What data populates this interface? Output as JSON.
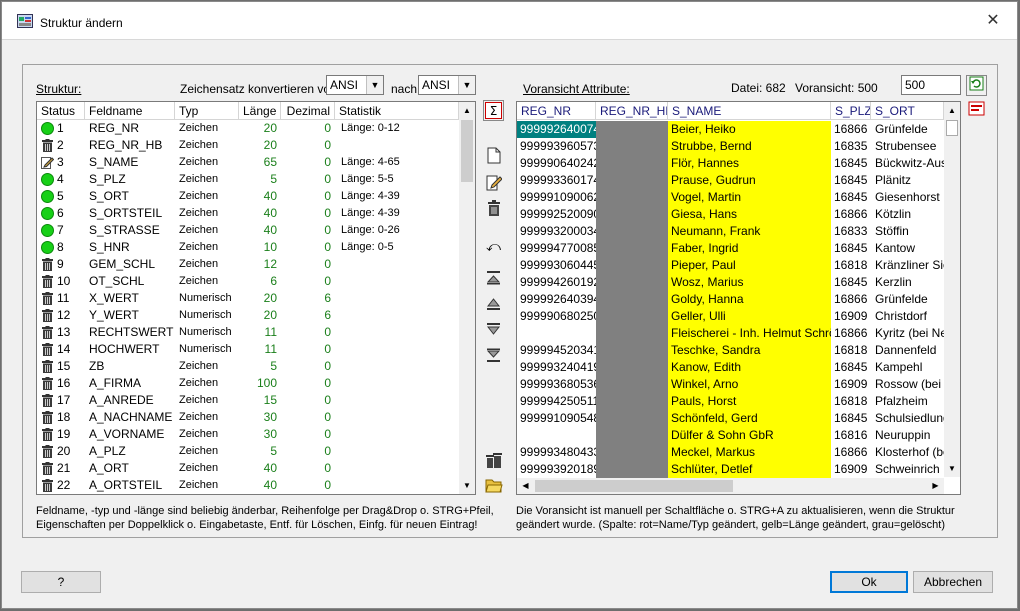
{
  "window": {
    "title": "Struktur ändern"
  },
  "left": {
    "title": "Struktur:",
    "charset_label": "Zeichensatz konvertieren von",
    "charset_from": "ANSI",
    "charset_to_label": "nach",
    "charset_to": "ANSI",
    "columns": [
      "Status",
      "Feldname",
      "Typ",
      "Länge",
      "Dezimal",
      "Statistik"
    ],
    "rows": [
      {
        "status": "green",
        "nr": "1",
        "name": "REG_NR",
        "typ": "Zeichen",
        "len": "20",
        "dez": "0",
        "stat": "Länge: 0-12"
      },
      {
        "status": "trash",
        "nr": "2",
        "name": "REG_NR_HB",
        "typ": "Zeichen",
        "len": "20",
        "dez": "0",
        "stat": ""
      },
      {
        "status": "edit",
        "nr": "3",
        "name": "S_NAME",
        "typ": "Zeichen",
        "len": "65",
        "dez": "0",
        "stat": "Länge: 4-65"
      },
      {
        "status": "green",
        "nr": "4",
        "name": "S_PLZ",
        "typ": "Zeichen",
        "len": "5",
        "dez": "0",
        "stat": "Länge: 5-5"
      },
      {
        "status": "green",
        "nr": "5",
        "name": "S_ORT",
        "typ": "Zeichen",
        "len": "40",
        "dez": "0",
        "stat": "Länge: 4-39"
      },
      {
        "status": "green",
        "nr": "6",
        "name": "S_ORTSTEIL",
        "typ": "Zeichen",
        "len": "40",
        "dez": "0",
        "stat": "Länge: 4-39"
      },
      {
        "status": "green",
        "nr": "7",
        "name": "S_STRASSE",
        "typ": "Zeichen",
        "len": "40",
        "dez": "0",
        "stat": "Länge: 0-26"
      },
      {
        "status": "green",
        "nr": "8",
        "name": "S_HNR",
        "typ": "Zeichen",
        "len": "10",
        "dez": "0",
        "stat": "Länge: 0-5"
      },
      {
        "status": "trash",
        "nr": "9",
        "name": "GEM_SCHL",
        "typ": "Zeichen",
        "len": "12",
        "dez": "0",
        "stat": ""
      },
      {
        "status": "trash",
        "nr": "10",
        "name": "OT_SCHL",
        "typ": "Zeichen",
        "len": "6",
        "dez": "0",
        "stat": ""
      },
      {
        "status": "trash",
        "nr": "11",
        "name": "X_WERT",
        "typ": "Numerisch",
        "len": "20",
        "dez": "6",
        "stat": ""
      },
      {
        "status": "trash",
        "nr": "12",
        "name": "Y_WERT",
        "typ": "Numerisch",
        "len": "20",
        "dez": "6",
        "stat": ""
      },
      {
        "status": "trash",
        "nr": "13",
        "name": "RECHTSWERT",
        "typ": "Numerisch",
        "len": "11",
        "dez": "0",
        "stat": ""
      },
      {
        "status": "trash",
        "nr": "14",
        "name": "HOCHWERT",
        "typ": "Numerisch",
        "len": "11",
        "dez": "0",
        "stat": ""
      },
      {
        "status": "trash",
        "nr": "15",
        "name": "ZB",
        "typ": "Zeichen",
        "len": "5",
        "dez": "0",
        "stat": ""
      },
      {
        "status": "trash",
        "nr": "16",
        "name": "A_FIRMA",
        "typ": "Zeichen",
        "len": "100",
        "dez": "0",
        "stat": ""
      },
      {
        "status": "trash",
        "nr": "17",
        "name": "A_ANREDE",
        "typ": "Zeichen",
        "len": "15",
        "dez": "0",
        "stat": ""
      },
      {
        "status": "trash",
        "nr": "18",
        "name": "A_NACHNAME",
        "typ": "Zeichen",
        "len": "30",
        "dez": "0",
        "stat": ""
      },
      {
        "status": "trash",
        "nr": "19",
        "name": "A_VORNAME",
        "typ": "Zeichen",
        "len": "30",
        "dez": "0",
        "stat": ""
      },
      {
        "status": "trash",
        "nr": "20",
        "name": "A_PLZ",
        "typ": "Zeichen",
        "len": "5",
        "dez": "0",
        "stat": ""
      },
      {
        "status": "trash",
        "nr": "21",
        "name": "A_ORT",
        "typ": "Zeichen",
        "len": "40",
        "dez": "0",
        "stat": ""
      },
      {
        "status": "trash",
        "nr": "22",
        "name": "A_ORTSTEIL",
        "typ": "Zeichen",
        "len": "40",
        "dez": "0",
        "stat": ""
      }
    ],
    "help_line1": "Feldname, -typ und -länge sind beliebig änderbar, Reihenfolge per Drag&Drop o. STRG+Pfeil,",
    "help_line2": "Eigenschaften per Doppelklick o. Eingabetaste, Entf. für Löschen, Einfg. für neuen Eintrag!"
  },
  "toolbar": {
    "icons": [
      "sum-icon",
      "new-icon",
      "edit-icon",
      "delete-icon",
      "undo-icon",
      "move-top-icon",
      "move-up-icon",
      "move-down-icon",
      "move-bottom-icon",
      "delete-all-icon",
      "open-folder-icon"
    ]
  },
  "right": {
    "title": "Voransicht Attribute:",
    "datei_label": "Datei: 682",
    "voransicht_label": "Voransicht: 500",
    "count_value": "500",
    "columns": [
      "REG_NR",
      "REG_NR_HB",
      "S_NAME",
      "S_PLZ",
      "S_ORT"
    ],
    "rows": [
      {
        "reg": "999992640074",
        "name": "Beier, Heiko",
        "plz": "16866",
        "ort": "Grünfelde"
      },
      {
        "reg": "999993960573",
        "name": "Strubbe, Bernd",
        "plz": "16835",
        "ort": "Strubensee"
      },
      {
        "reg": "999990640242",
        "name": "Flör, Hannes",
        "plz": "16845",
        "ort": "Bückwitz-Ausba"
      },
      {
        "reg": "999993360174",
        "name": "Prause, Gudrun",
        "plz": "16845",
        "ort": "Plänitz"
      },
      {
        "reg": "999991090062",
        "name": "Vogel, Martin",
        "plz": "16845",
        "ort": "Giesenhorst"
      },
      {
        "reg": "999992520090",
        "name": "Giesa, Hans",
        "plz": "16866",
        "ort": "Kötzlin"
      },
      {
        "reg": "999993200034",
        "name": "Neumann, Frank",
        "plz": "16833",
        "ort": "Stöffin"
      },
      {
        "reg": "999994770085",
        "name": "Faber, Ingrid",
        "plz": "16845",
        "ort": "Kantow"
      },
      {
        "reg": "999993060445",
        "name": "Pieper, Paul",
        "plz": "16818",
        "ort": "Kränzliner Siedl"
      },
      {
        "reg": "999994260192",
        "name": "Wosz, Marius",
        "plz": "16845",
        "ort": "Kerzlin"
      },
      {
        "reg": "999992640394",
        "name": "Goldy, Hanna",
        "plz": "16866",
        "ort": "Grünfelde"
      },
      {
        "reg": "999990680250",
        "name": "Geller, Ulli",
        "plz": "16909",
        "ort": "Christdorf"
      },
      {
        "reg": "",
        "name": "Fleischerei - Inh. Helmut Schröder",
        "plz": "16866",
        "ort": "Kyritz (bei Neur"
      },
      {
        "reg": "999994520341",
        "name": "Teschke, Sandra",
        "plz": "16818",
        "ort": "Dannenfeld"
      },
      {
        "reg": "999993240419",
        "name": "Kanow, Edith",
        "plz": "16845",
        "ort": "Kampehl"
      },
      {
        "reg": "999993680536",
        "name": "Winkel, Arno",
        "plz": "16909",
        "ort": "Rossow (bei W"
      },
      {
        "reg": "999994250511",
        "name": "Pauls, Horst",
        "plz": "16818",
        "ort": "Pfalzheim"
      },
      {
        "reg": "999991090548",
        "name": "Schönfeld, Gerd",
        "plz": "16845",
        "ort": "Schulsiedlung"
      },
      {
        "reg": "",
        "name": "Dülfer & Sohn GbR",
        "plz": "16816",
        "ort": "Neuruppin"
      },
      {
        "reg": "999993480433",
        "name": "Meckel, Markus",
        "plz": "16866",
        "ort": "Klosterhof (bei"
      },
      {
        "reg": "999993920189",
        "name": "Schlüter, Detlef",
        "plz": "16909",
        "ort": "Schweinrich"
      }
    ],
    "help_line1": "Die Voransicht ist manuell per Schaltfläche o. STRG+A zu aktualisieren, wenn die Struktur",
    "help_line2": "geändert wurde. (Spalte: rot=Name/Typ geändert, gelb=Länge geändert, grau=gelöscht)"
  },
  "buttons": {
    "help": "?",
    "ok": "Ok",
    "cancel": "Abbrechen"
  },
  "colors": {
    "status_green": "#17d017",
    "changed_length": "#ffff00",
    "deleted": "#808080",
    "selection": "#008080"
  }
}
